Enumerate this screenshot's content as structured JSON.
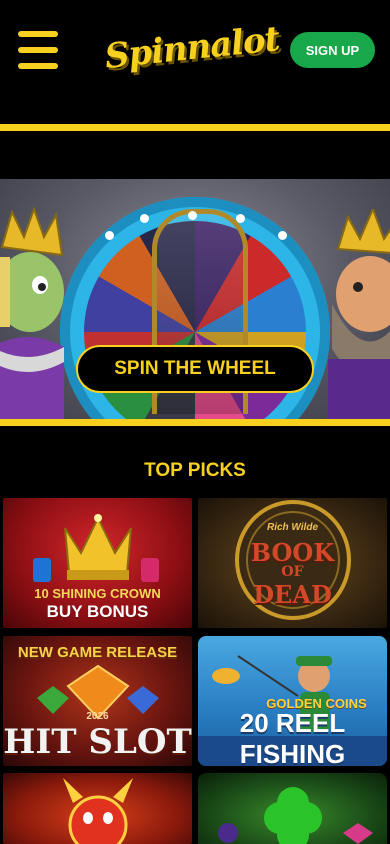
{
  "header": {
    "logo_text": "Spinnalot",
    "signup_label": "SIGN UP",
    "menu_icon": "hamburger-menu-icon"
  },
  "banner": {
    "cta_label": "SPIN THE WHEEL"
  },
  "section": {
    "title": "TOP PICKS"
  },
  "games": [
    {
      "line1": "10",
      "line2": "SHINING CROWN",
      "line3": "BUY BONUS"
    },
    {
      "line1": "Rich Wilde",
      "line2": "BOOK",
      "line3": "OF",
      "line4": "DEAD"
    },
    {
      "line1": "NEW GAME RELEASE",
      "line2": "2026",
      "line3": "HIT SLOT"
    },
    {
      "line1": "GOLDEN COINS",
      "line2": "20",
      "line3": "REEL FISHING"
    }
  ],
  "colors": {
    "accent": "#f7d11e",
    "signup": "#18a84a",
    "background": "#000000"
  }
}
